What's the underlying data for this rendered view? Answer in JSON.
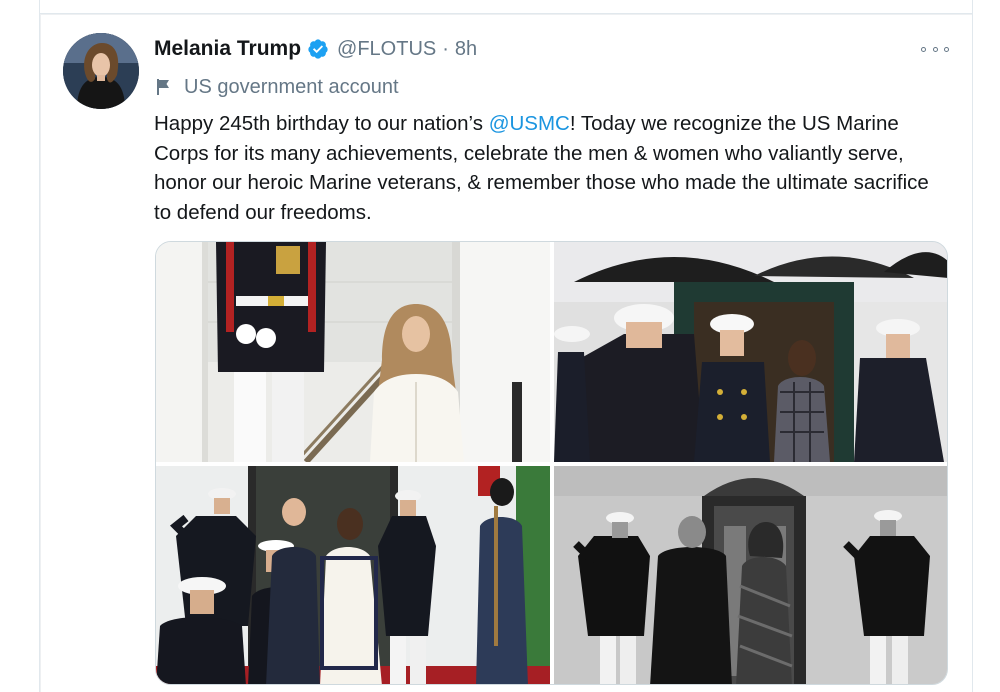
{
  "tweet": {
    "display_name": "Melania Trump",
    "handle": "@FLOTUS",
    "separator": "·",
    "time": "8h",
    "label": "US government account",
    "text_before": "Happy 245th birthday to our nation’s ",
    "mention": "@USMC",
    "text_after": "! Today we recognize the US Marine Corps for its many achievements, celebrate the men & women who valiantly serve, honor our heroic Marine veterans, & remember those who made the ultimate sacrifice to defend our freedoms."
  },
  "icons": {
    "verified": "verified-badge-icon",
    "government": "flag-icon",
    "more": "more-options-icon"
  },
  "colors": {
    "link": "#1b95e0",
    "verified": "#1da1f2",
    "secondary_text": "#657786",
    "primary_text": "#14171a"
  },
  "media": [
    {
      "name": "photo-1",
      "type": "photo"
    },
    {
      "name": "photo-2",
      "type": "photo"
    },
    {
      "name": "photo-3",
      "type": "photo"
    },
    {
      "name": "photo-4",
      "type": "photo"
    }
  ]
}
